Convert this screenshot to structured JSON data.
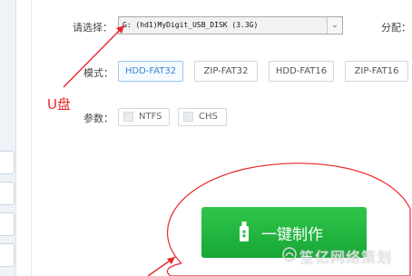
{
  "form": {
    "device_label": "请选择：",
    "device_value": "G: (hd1)MyDigit_USB_DISK (3.3G)",
    "alloc_label": "分配：",
    "mode_label": "模式：",
    "params_label": "参数："
  },
  "modes": [
    "HDD-FAT32",
    "ZIP-FAT32",
    "HDD-FAT16",
    "ZIP-FAT16"
  ],
  "active_mode": "HDD-FAT32",
  "params": [
    "NTFS",
    "CHS"
  ],
  "make_button": {
    "label": "一键制作"
  },
  "annotation": {
    "text": "U盘",
    "color": "#e8262a"
  },
  "watermark": {
    "text": "笙亿网络策划"
  },
  "colors": {
    "accent_green": "#1fb33f",
    "active_blue": "#3a86d8"
  }
}
